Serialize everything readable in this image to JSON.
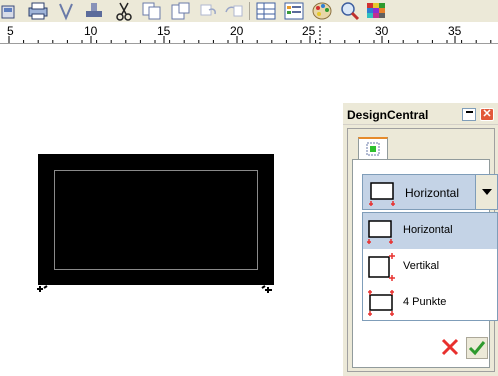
{
  "window": {
    "title": "DesignCentral"
  },
  "toolbar": {
    "icons": [
      "unknown-icon",
      "print-icon",
      "pen-icon",
      "stamp-icon",
      "cut-icon",
      "copy-icon",
      "paste-icon",
      "undo-icon",
      "redo-icon",
      "grid-icon",
      "properties-icon",
      "palette-icon",
      "zoom-icon",
      "color-grid-icon"
    ]
  },
  "ruler": {
    "labels": [
      "5",
      "10",
      "15",
      "20",
      "25",
      "30",
      "35"
    ]
  },
  "panel": {
    "dropdown_value": "Horizontal",
    "list_items": [
      {
        "label": "Horizontal",
        "selected": true
      },
      {
        "label": "Vertikal",
        "selected": false
      },
      {
        "label": "4 Punkte",
        "selected": false
      }
    ]
  },
  "colors": {
    "accent_red": "#e8302e",
    "ok_green": "#2e9a2e",
    "selection": "#c4d3e6"
  }
}
